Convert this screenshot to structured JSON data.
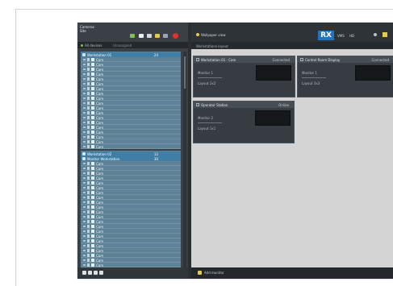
{
  "app": {
    "title_line1": "Cameras",
    "title_line2": "Site",
    "left_toolbar_label": "All devices",
    "left_toolbar_label2": "Unassigned",
    "right_title": "Wallpaper view",
    "right_subtitle": "Workstations layout",
    "logo": "RX",
    "logo_tag1": "VMS",
    "logo_tag2": "HD",
    "footer_label": "Add monitor"
  },
  "colors": {
    "accent_blue": "#33a3df",
    "group_header": "#3f7fa6",
    "tree_bg": "#5d8296",
    "record_red": "#e0312a",
    "status_yellow": "#e7c94a",
    "status_green": "#7cc24e"
  },
  "toolbar_icons": [
    {
      "name": "snapshot-icon",
      "color": "#7cc24e"
    },
    {
      "name": "monitor-icon",
      "color": "#e9eef1"
    },
    {
      "name": "grid-icon",
      "color": "#cfd8dc"
    },
    {
      "name": "layout-icon",
      "color": "#e7c94a"
    },
    {
      "name": "settings-icon",
      "color": "#9aa6ad"
    },
    {
      "name": "record-icon",
      "color": "#e0312a"
    }
  ],
  "groups": [
    {
      "name": "Workstation 01",
      "count": "24",
      "items": [
        "Cam",
        "Cam",
        "Cam",
        "Cam",
        "Cam",
        "Cam",
        "Cam",
        "Cam",
        "Cam",
        "Cam",
        "Cam",
        "Cam",
        "Cam",
        "Cam",
        "Cam",
        "Cam",
        "Cam",
        "Cam",
        "Cam"
      ]
    },
    {
      "name": "Workstation 02",
      "count": "12",
      "items": []
    },
    {
      "name": "Monitor Workstation",
      "count": "30",
      "items": [
        "Cam",
        "Cam",
        "Cam",
        "Cam",
        "Cam",
        "Cam",
        "Cam",
        "Cam",
        "Cam",
        "Cam",
        "Cam",
        "Cam",
        "Cam",
        "Cam",
        "Cam",
        "Cam",
        "Cam",
        "Cam",
        "Cam",
        "Cam",
        "Cam",
        "Cam",
        "Cam",
        "Cam",
        "Cam",
        "Cam"
      ]
    }
  ],
  "cards": [
    {
      "title": "Workstation 01 - Cam",
      "status": "Connected",
      "line1": "Monitor 1",
      "line2": "Layout 2x2"
    },
    {
      "title": "Control Room Display",
      "status": "Connected",
      "line1": "Monitor 1",
      "line2": "Layout 3x3"
    },
    {
      "title": "Operator Station",
      "status": "Online",
      "line1": "Monitor 2",
      "line2": "Layout 1x1"
    }
  ]
}
